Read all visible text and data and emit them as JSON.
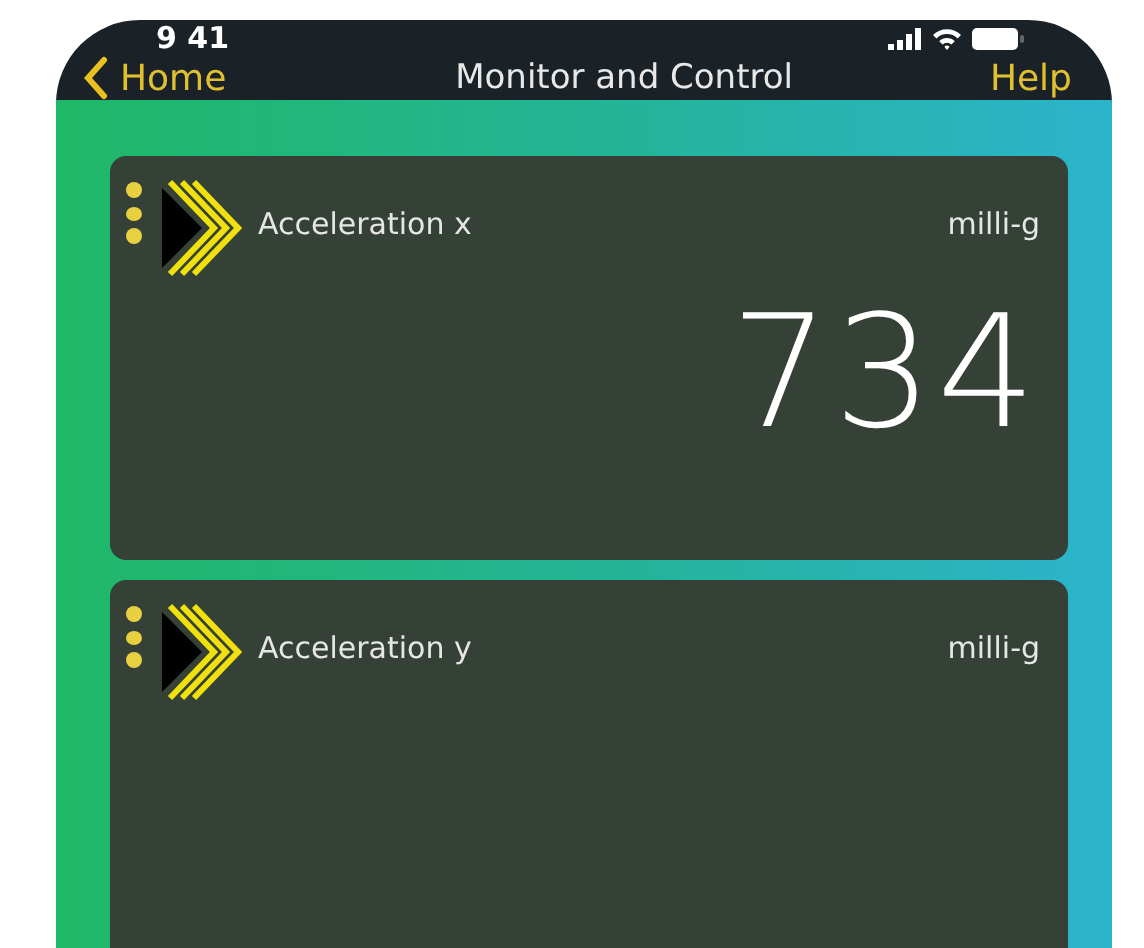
{
  "status_bar": {
    "time": "9 41"
  },
  "nav_bar": {
    "back": "Home",
    "title": "Monitor and Control",
    "action": "Help"
  },
  "sensors": [
    {
      "name": "Acceleration x",
      "unit": "milli-g",
      "value": "734"
    },
    {
      "name": "Acceleration y",
      "unit": "milli-g"
    }
  ]
}
